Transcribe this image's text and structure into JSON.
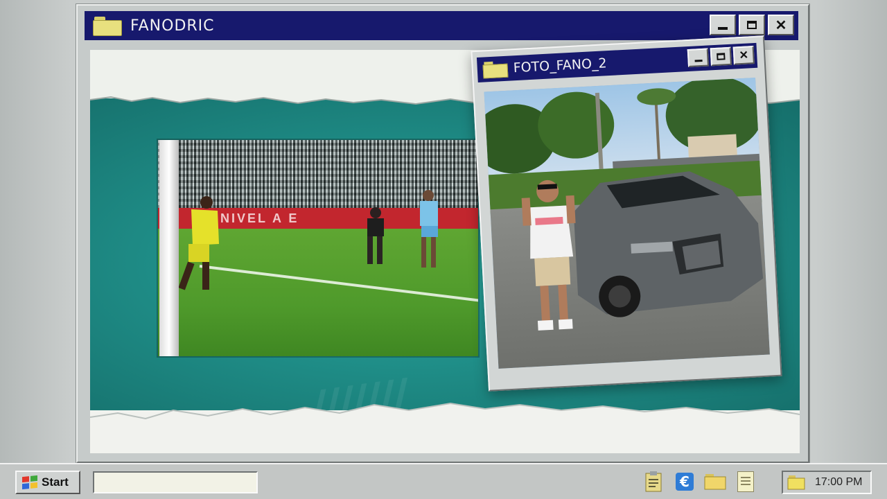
{
  "main_window": {
    "title": "FANODRIC",
    "controls": {
      "minimize": "minimize",
      "maximize": "maximize",
      "close": "✕"
    }
  },
  "video_still": {
    "ad_text": "NIVEL      A E"
  },
  "photo_window": {
    "title": "FOTO_FANO_2",
    "controls": {
      "minimize": "minimize",
      "maximize": "maximize",
      "close": "✕"
    }
  },
  "taskbar": {
    "start_label": "Start",
    "clock": "17:00 PM",
    "tray_icons": [
      "clipboard-icon",
      "e-icon",
      "folder-icon",
      "notepad-icon"
    ]
  },
  "colors": {
    "titlebar": "#17196d",
    "teal": "#1f8d87",
    "folder": "#e8e07e"
  }
}
